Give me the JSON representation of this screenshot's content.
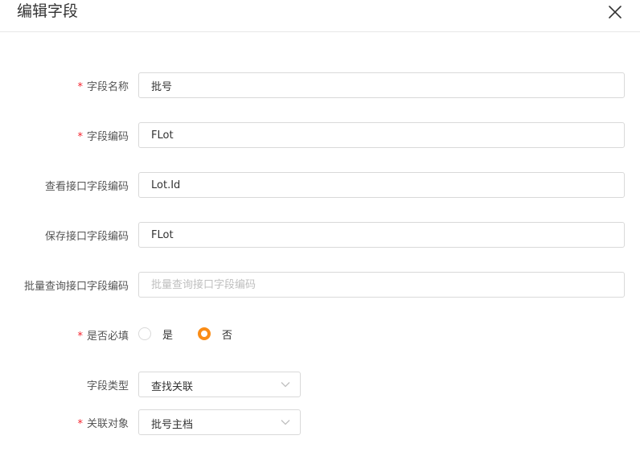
{
  "dialog": {
    "title": "编辑字段",
    "close_icon": "close-icon"
  },
  "fields": {
    "field_name": {
      "label": "字段名称",
      "required": true,
      "value": "批号",
      "placeholder": ""
    },
    "field_code": {
      "label": "字段编码",
      "required": true,
      "value": "FLot",
      "placeholder": ""
    },
    "view_api_field_code": {
      "label": "查看接口字段编码",
      "required": false,
      "value": "Lot.Id",
      "placeholder": ""
    },
    "save_api_field_code": {
      "label": "保存接口字段编码",
      "required": false,
      "value": "FLot",
      "placeholder": ""
    },
    "batch_query_api_field_code": {
      "label": "批量查询接口字段编码",
      "required": false,
      "value": "",
      "placeholder": "批量查询接口字段编码"
    }
  },
  "required_choice": {
    "label": "是否必填",
    "required": true,
    "options": [
      {
        "label": "是",
        "checked": false
      },
      {
        "label": "否",
        "checked": true
      }
    ]
  },
  "field_type": {
    "label": "字段类型",
    "required": false,
    "value": "查找关联",
    "icon": "chevron-down-icon"
  },
  "related_object": {
    "label": "关联对象",
    "required": true,
    "value": "批号主档",
    "icon": "chevron-down-icon"
  },
  "required_mark": "*",
  "colors": {
    "accent": "#fa8c16",
    "required": "#f5222d",
    "border": "#d9d9d9"
  }
}
